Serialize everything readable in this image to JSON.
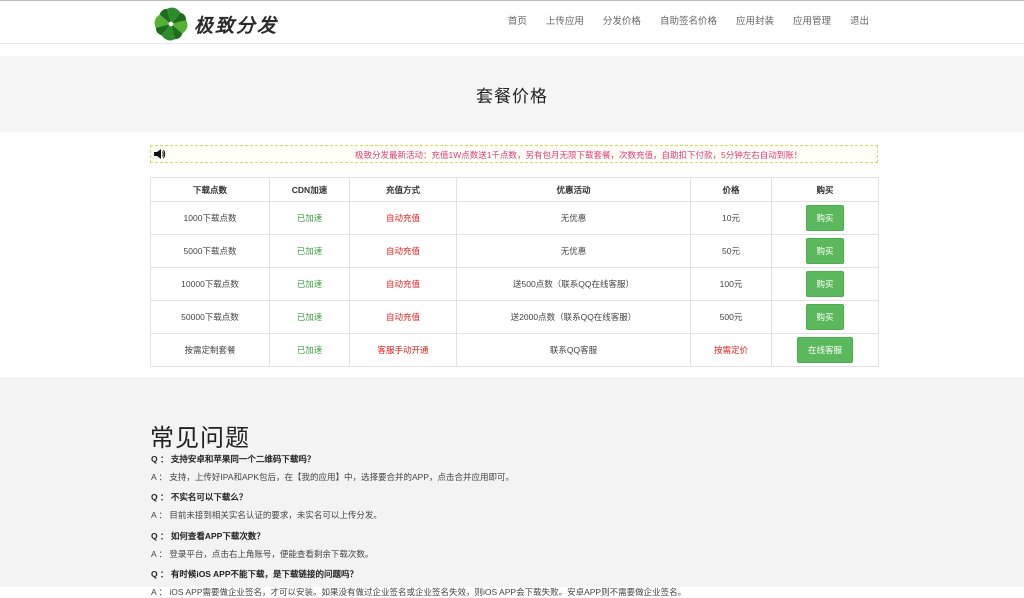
{
  "header": {
    "logo_text": "极致分发",
    "nav": [
      "首页",
      "上传应用",
      "分发价格",
      "自助签名价格",
      "应用封装",
      "应用管理",
      "退出"
    ]
  },
  "page_title": "套餐价格",
  "notice": "极致分发最新活动：充值1W点数送1千点数，另有包月无限下载套餐，次数充值，自助扣下付款，5分钟左右自动到账！",
  "table": {
    "headers": [
      "下载点数",
      "CDN加速",
      "充值方式",
      "优惠活动",
      "价格",
      "购买"
    ],
    "rows": [
      {
        "points": "1000下载点数",
        "cdn": "已加速",
        "method": "自动充值",
        "promo": "无优惠",
        "price": "10元",
        "action": "购买"
      },
      {
        "points": "5000下载点数",
        "cdn": "已加速",
        "method": "自动充值",
        "promo": "无优惠",
        "price": "50元",
        "action": "购买"
      },
      {
        "points": "10000下载点数",
        "cdn": "已加速",
        "method": "自动充值",
        "promo": "送500点数（联系QQ在线客服）",
        "price": "100元",
        "action": "购买"
      },
      {
        "points": "50000下载点数",
        "cdn": "已加速",
        "method": "自动充值",
        "promo": "送2000点数（联系QQ在线客服）",
        "price": "500元",
        "action": "购买"
      },
      {
        "points": "按需定制套餐",
        "cdn": "已加速",
        "method": "客服手动开通",
        "promo": "联系QQ客服",
        "price": "按需定价",
        "action": "在线客服"
      }
    ]
  },
  "faq": {
    "title": "常见问题",
    "items": [
      {
        "q": "Q ： 支持安卓和苹果同一个二维码下载吗？",
        "a": "A ： 支持，上传好IPA和APK包后，在【我的应用】中，选择要合并的APP，点击合并应用即可。"
      },
      {
        "q": "Q ： 不实名可以下载么？",
        "a": "A ： 目前未接到相关实名认证的要求，未实名可以上传分发。"
      },
      {
        "q": "Q ： 如何查看APP下载次数？",
        "a": "A ： 登录平台，点击右上角账号，便能查看剩余下载次数。"
      },
      {
        "q": "Q ： 有时候iOS APP不能下载，是下载链接的问题吗？",
        "a": "A ： iOS APP需要做企业签名，才可以安装。如果没有做过企业签名或企业签名失效，则iOS APP会下载失败。安卓APP则不需要做企业签名。"
      }
    ]
  },
  "colors": {
    "accent_green": "#5cb85c",
    "notice_pink": "#e0397f",
    "status_green": "#3c9a3c",
    "status_red": "#e02020"
  }
}
